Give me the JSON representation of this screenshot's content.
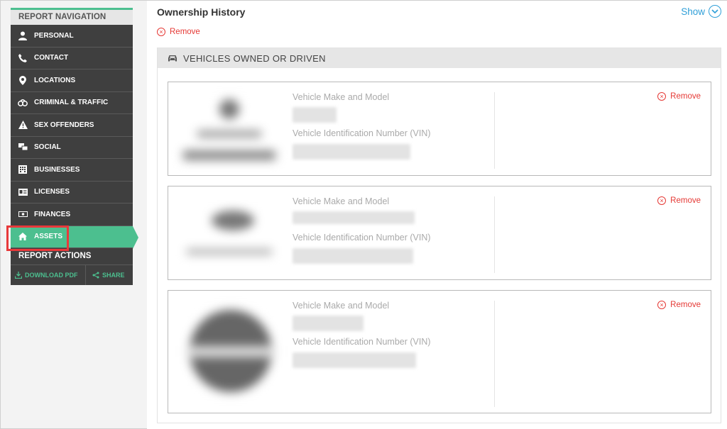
{
  "sidebar": {
    "header": "REPORT NAVIGATION",
    "items": [
      {
        "label": "PERSONAL",
        "icon": "person-icon"
      },
      {
        "label": "CONTACT",
        "icon": "phone-icon"
      },
      {
        "label": "LOCATIONS",
        "icon": "map-pin-icon"
      },
      {
        "label": "CRIMINAL & TRAFFIC",
        "icon": "handcuffs-icon"
      },
      {
        "label": "SEX OFFENDERS",
        "icon": "warning-icon"
      },
      {
        "label": "SOCIAL",
        "icon": "chat-icon"
      },
      {
        "label": "BUSINESSES",
        "icon": "building-icon"
      },
      {
        "label": "LICENSES",
        "icon": "id-card-icon"
      },
      {
        "label": "FINANCES",
        "icon": "money-icon"
      },
      {
        "label": "ASSETS",
        "icon": "home-icon",
        "active": true
      }
    ],
    "actions_header": "REPORT ACTIONS",
    "download_pdf": "DOWNLOAD PDF",
    "share": "SHARE"
  },
  "main": {
    "title": "Ownership History",
    "show": "Show",
    "remove": "Remove",
    "section_title": "VEHICLES OWNED OR DRIVEN",
    "cards": [
      {
        "make_label": "Vehicle Make and Model",
        "vin_label": "Vehicle Identification Number (VIN)",
        "remove": "Remove"
      },
      {
        "make_label": "Vehicle Make and Model",
        "vin_label": "Vehicle Identification Number (VIN)",
        "remove": "Remove"
      },
      {
        "make_label": "Vehicle Make and Model",
        "vin_label": "Vehicle Identification Number (VIN)",
        "remove": "Remove"
      }
    ]
  },
  "colors": {
    "accent": "#4cbf8f",
    "nav_bg": "#3f3f3f",
    "link": "#2f9fd8",
    "remove": "#e53935",
    "highlight": "#e8393b"
  }
}
